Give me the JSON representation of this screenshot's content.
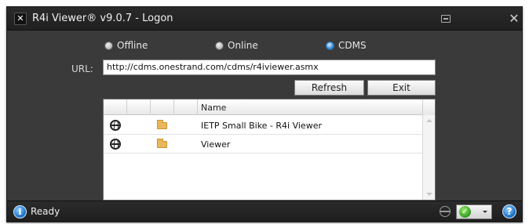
{
  "window": {
    "title": "R4i Viewer® v9.0.7 - Logon",
    "app_icon": "tools-icon",
    "keyboard_icon": "keyboard-icon",
    "close_glyph": "✕"
  },
  "connection_modes": [
    {
      "label": "Offline",
      "selected": false
    },
    {
      "label": "Online",
      "selected": false
    },
    {
      "label": "CDMS",
      "selected": true
    }
  ],
  "url": {
    "label": "URL:",
    "value": "http://cdms.onestrand.com/cdms/r4iviewer.asmx"
  },
  "buttons": {
    "refresh": "Refresh",
    "exit": "Exit"
  },
  "grid": {
    "column_header": "Name",
    "rows": [
      {
        "icon": "globe-icon",
        "type_icon": "folder-icon",
        "name": "IETP Small Bike - R4i Viewer"
      },
      {
        "icon": "globe-icon",
        "type_icon": "folder-icon",
        "name": "Viewer"
      }
    ]
  },
  "status": {
    "text": "Ready",
    "info_glyph": "i",
    "check_glyph": "✓",
    "help_glyph": "?"
  },
  "colors": {
    "window_bg": "#3a3a3a",
    "titlebar_bg": "#222222",
    "selected_radio": "#3a8fd6",
    "accent_blue": "#1d6fc4"
  }
}
